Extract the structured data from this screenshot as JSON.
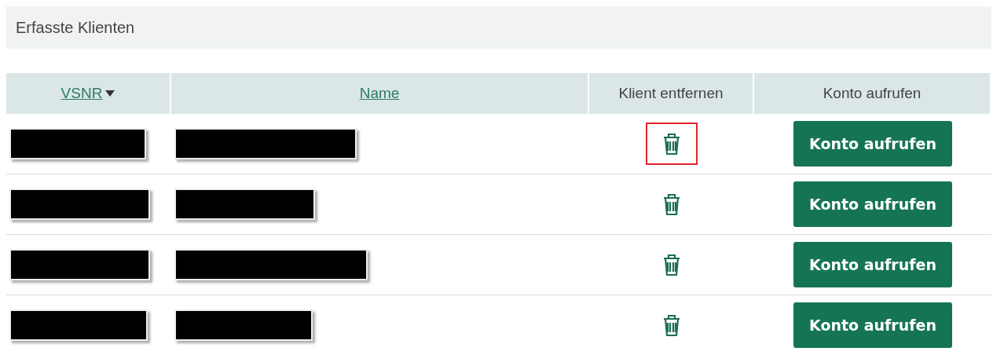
{
  "panel": {
    "title": "Erfasste Klienten"
  },
  "table": {
    "columns": [
      {
        "label": "VSNR",
        "kind": "link",
        "sorted": true
      },
      {
        "label": "Name",
        "kind": "link",
        "sorted": false
      },
      {
        "label": "Klient entfernen",
        "kind": "plain"
      },
      {
        "label": "Konto aufrufen",
        "kind": "plain"
      }
    ],
    "rows": [
      {
        "highlighted": true,
        "button": "Konto aufrufen"
      },
      {
        "highlighted": false,
        "button": "Konto aufrufen"
      },
      {
        "highlighted": false,
        "button": "Konto aufrufen"
      },
      {
        "highlighted": false,
        "button": "Konto aufrufen"
      }
    ]
  }
}
